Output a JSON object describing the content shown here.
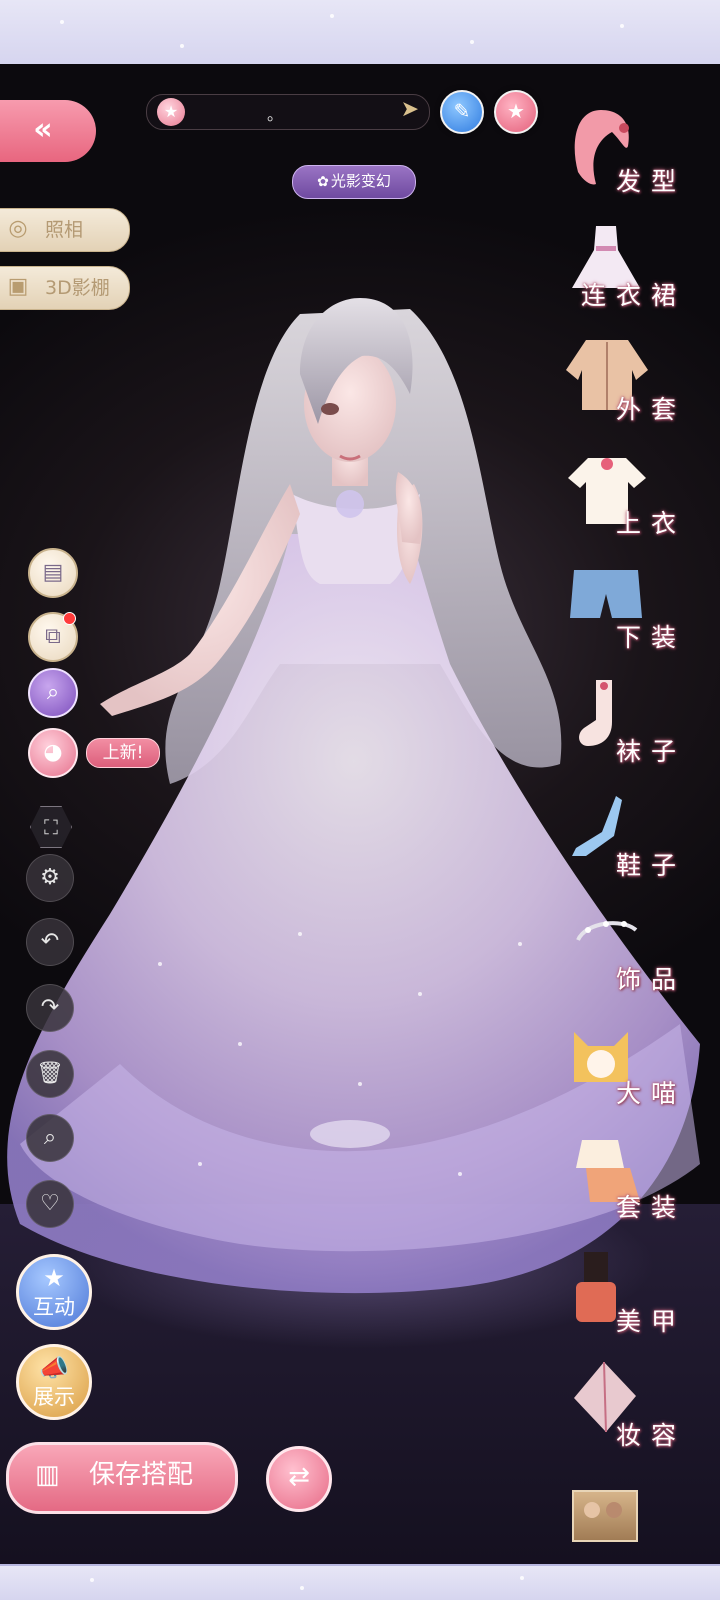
{
  "colors": {
    "accent_pink": "#e8667f",
    "gold": "#c9b38d",
    "purple": "#7d4fbd",
    "frame": "#d6d5ef"
  },
  "top_bar": {
    "selector_icon": "star-icon",
    "selector_text": "。",
    "next_icon": "chevron-right-icon",
    "edit_icon": "pen-icon",
    "favorite_icon": "star-icon"
  },
  "light_effect": {
    "label": "光影变幻",
    "icon": "flower-icon"
  },
  "left_menu": {
    "back_icon": "double-chevron-left-icon",
    "photo_label": "照相",
    "studio_label": "3D影棚"
  },
  "tools": {
    "new_badge": "上新!",
    "items": [
      {
        "name": "wardrobe-icon"
      },
      {
        "name": "layers-icon",
        "has_notification": true
      },
      {
        "name": "search-filter-icon"
      },
      {
        "name": "palette-icon"
      },
      {
        "name": "fullscreen-icon"
      },
      {
        "name": "settings-icon"
      },
      {
        "name": "undo-icon"
      },
      {
        "name": "redo-icon"
      },
      {
        "name": "trash-icon"
      },
      {
        "name": "magnify-icon"
      },
      {
        "name": "heart-icon"
      }
    ],
    "interact_label": "互动",
    "showcase_label": "展示"
  },
  "bottom": {
    "save_label": "保存搭配",
    "swap_icon": "swap-icon"
  },
  "categories": [
    {
      "label": "发型",
      "icon": "hair-icon"
    },
    {
      "label": "连衣裙",
      "icon": "dress-icon"
    },
    {
      "label": "外套",
      "icon": "coat-icon"
    },
    {
      "label": "上衣",
      "icon": "shirt-icon"
    },
    {
      "label": "下装",
      "icon": "shorts-icon"
    },
    {
      "label": "袜子",
      "icon": "sock-icon"
    },
    {
      "label": "鞋子",
      "icon": "shoe-icon"
    },
    {
      "label": "饰品",
      "icon": "tiara-icon"
    },
    {
      "label": "大喵",
      "icon": "cat-icon"
    },
    {
      "label": "套装",
      "icon": "outfit-icon"
    },
    {
      "label": "美甲",
      "icon": "nail-polish-icon"
    },
    {
      "label": "妆容",
      "icon": "makeup-icon"
    }
  ]
}
